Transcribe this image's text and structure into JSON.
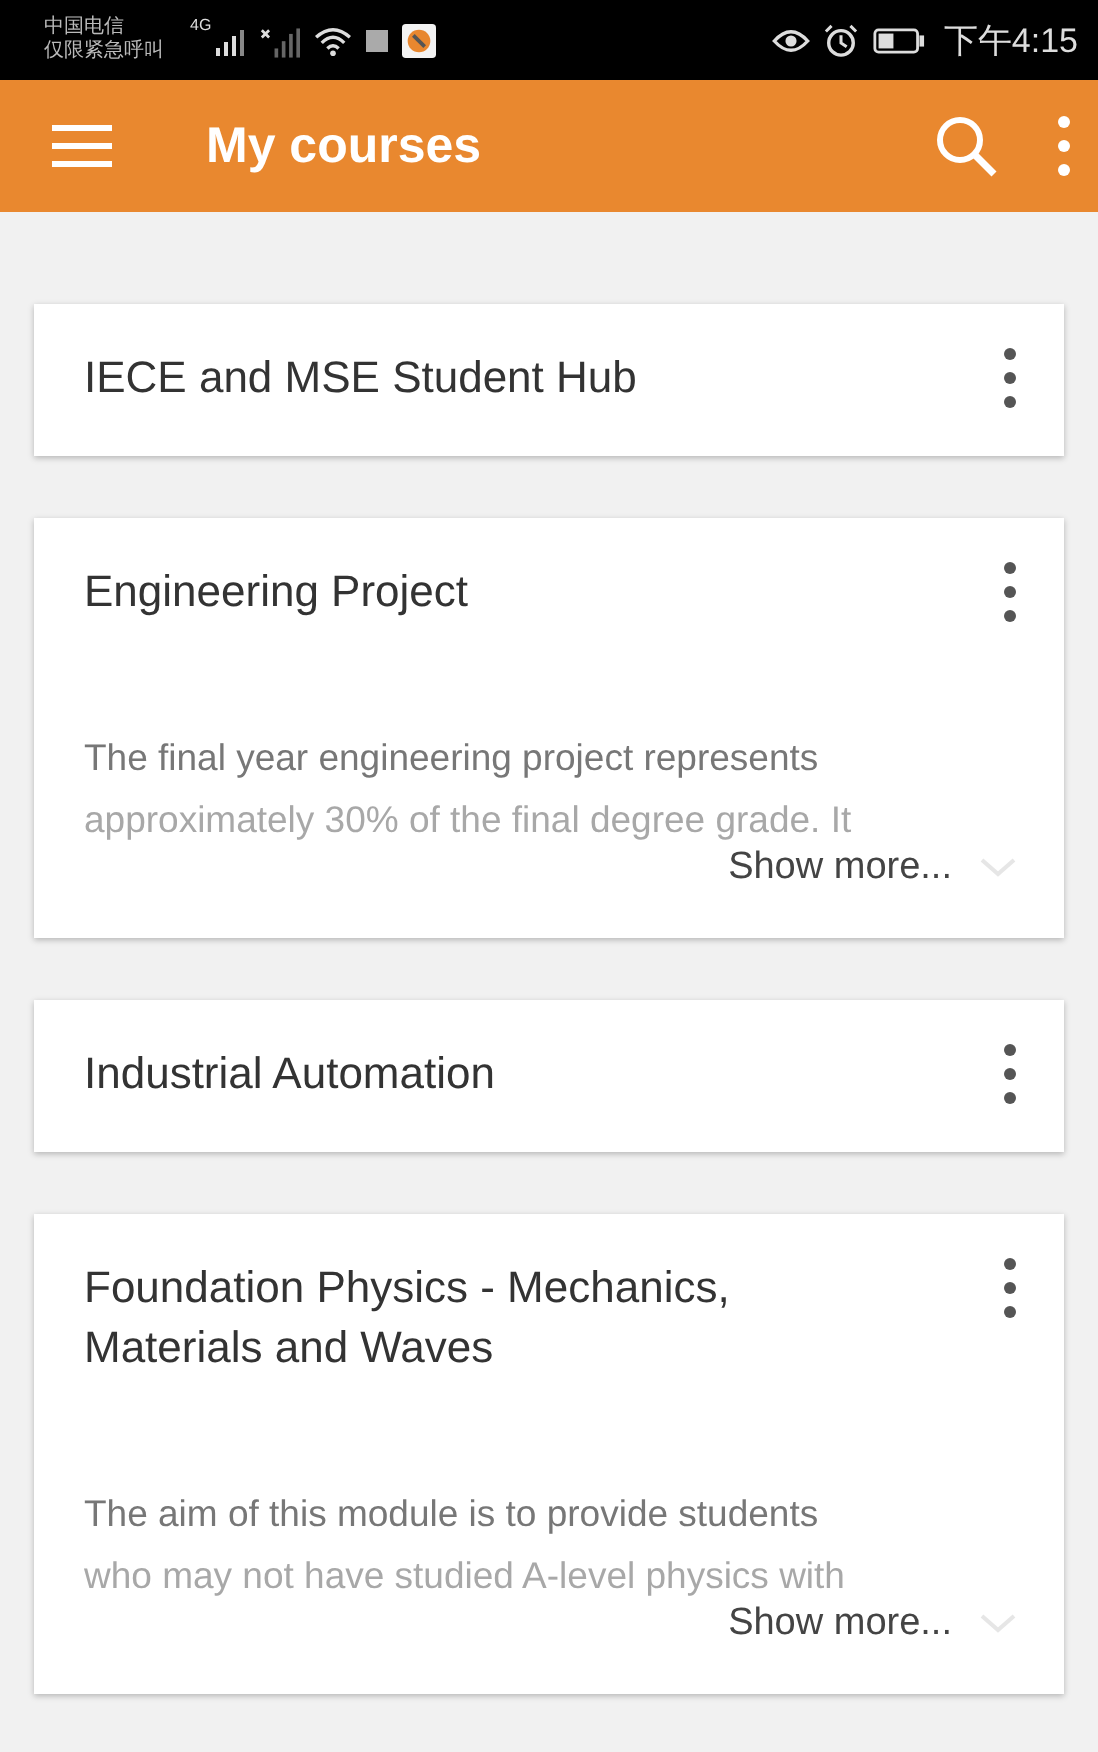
{
  "status_bar": {
    "carrier_lines": [
      "中国电信",
      "仅限紧急呼叫"
    ],
    "network": "4G",
    "time": "下午4:15"
  },
  "app_bar": {
    "title": "My courses"
  },
  "courses": [
    {
      "title": "IECE and MSE Student Hub"
    },
    {
      "title": "Engineering Project",
      "summary_lines": [
        "The final year engineering project represents",
        "approximately 30% of the final degree grade. It"
      ],
      "show_more": "Show more..."
    },
    {
      "title": "Industrial Automation"
    },
    {
      "title": "Foundation Physics - Mechanics, Materials and Waves",
      "summary_lines": [
        "The aim of this module is to provide students",
        "who may not have studied A-level physics with"
      ],
      "show_more": "Show more..."
    }
  ]
}
